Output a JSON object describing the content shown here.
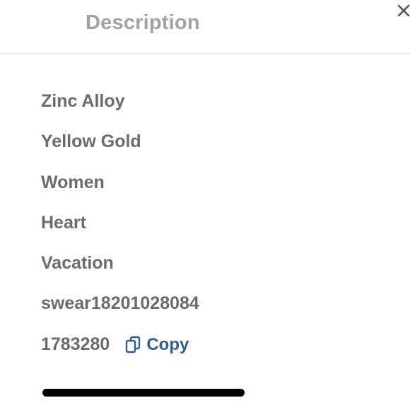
{
  "header": {
    "title": "Description",
    "close_icon": "close-icon"
  },
  "details": {
    "items": [
      "Zinc Alloy",
      "Yellow Gold",
      "Women",
      "Heart",
      "Vacation",
      "swear18201028084",
      "1783280"
    ],
    "copy_label": "Copy",
    "copy_icon": "copy-icon"
  },
  "colors": {
    "title": "#a2a2a2",
    "text": "#6b6b6b",
    "link": "#2f5f92",
    "divider": "#e6e6e6"
  }
}
